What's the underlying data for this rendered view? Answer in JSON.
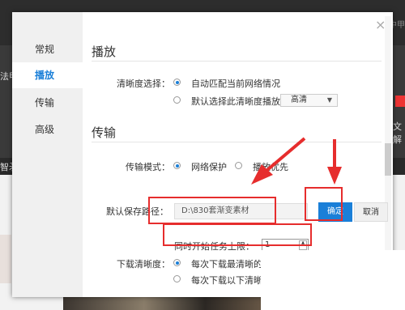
{
  "background": {
    "text_top_right": "中甲",
    "text_left_1": "法甲",
    "text_right_1": "文解",
    "text_left_2": "智矛"
  },
  "dialog": {
    "nav": [
      {
        "label": "常规"
      },
      {
        "label": "播放"
      },
      {
        "label": "传输"
      },
      {
        "label": "高级"
      }
    ],
    "close_label": "×",
    "play_section": {
      "title": "播放",
      "quality_label": "清晰度选择：",
      "option_auto": "自动匹配当前网络情况",
      "option_default": "默认选择此清晰度播放：",
      "select_value": "高清",
      "select_arrow": "▼"
    },
    "transfer_section": {
      "title": "传输",
      "mode_label": "传输模式：",
      "mode_protect": "网络保护",
      "mode_priority": "播放优先",
      "path_label": "默认保存路径：",
      "path_value": "D:\\830套渐变素材",
      "ok_label": "确定",
      "cancel_label": "取消",
      "tasks_label": "同时开始任务上限：",
      "tasks_value": "1",
      "download_label": "下载清晰度：",
      "download_opt1": "每次下载最清晰的版",
      "download_opt2": "每次下载以下清晰度"
    }
  },
  "colors": {
    "accent": "#1a7fd8",
    "highlight": "#e62d2d"
  }
}
